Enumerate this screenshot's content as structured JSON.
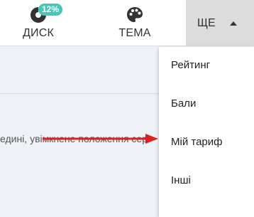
{
  "topbar": {
    "disk": {
      "label": "ДИСК",
      "badge": "12%",
      "icon": "disk-usage-icon"
    },
    "theme": {
      "label": "ТЕМА",
      "icon": "palette-icon"
    },
    "more": {
      "label": "ЩЕ",
      "icon": "caret-up-icon"
    }
  },
  "content": {
    "text": "едині, увімкнене  положення сер"
  },
  "dropdown": {
    "items": [
      {
        "label": "Рейтинг"
      },
      {
        "label": "Бали"
      },
      {
        "label": "Мій тариф"
      },
      {
        "label": "Інші"
      }
    ]
  },
  "colors": {
    "badge": "#48c7b8",
    "annotation_arrow": "#e02020"
  }
}
